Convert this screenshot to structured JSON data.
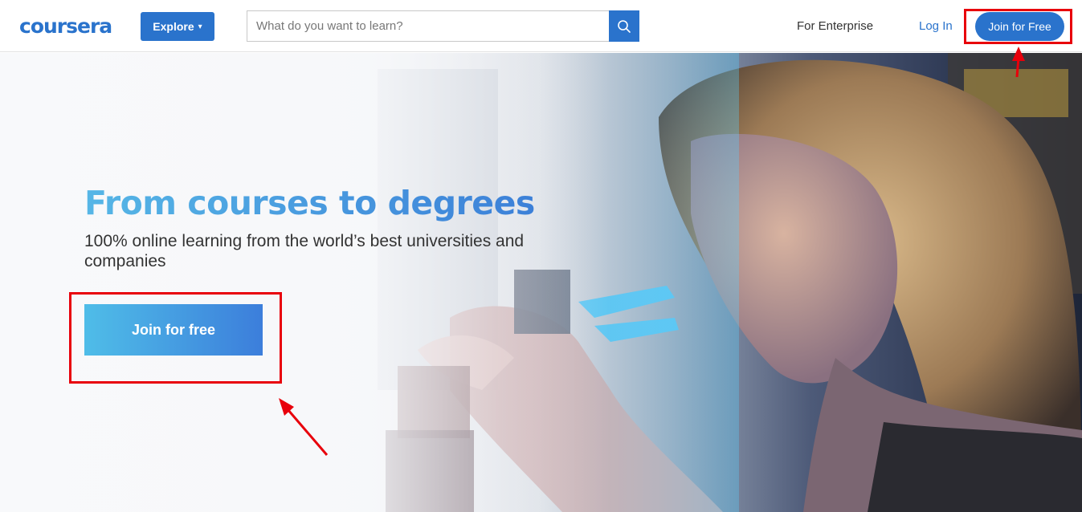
{
  "header": {
    "logo": "coursera",
    "explore_label": "Explore",
    "search_placeholder": "What do you want to learn?",
    "for_enterprise": "For Enterprise",
    "login": "Log In",
    "join_label": "Join for Free"
  },
  "hero": {
    "title": "From courses to degrees",
    "subtitle": "100% online learning from the world’s best universities and companies",
    "cta_label": "Join for free"
  },
  "colors": {
    "brand": "#2a73cc",
    "annotation": "#e8000b"
  },
  "icons": {
    "search": "search-icon",
    "explore_chevron": "chevron-down-icon"
  }
}
